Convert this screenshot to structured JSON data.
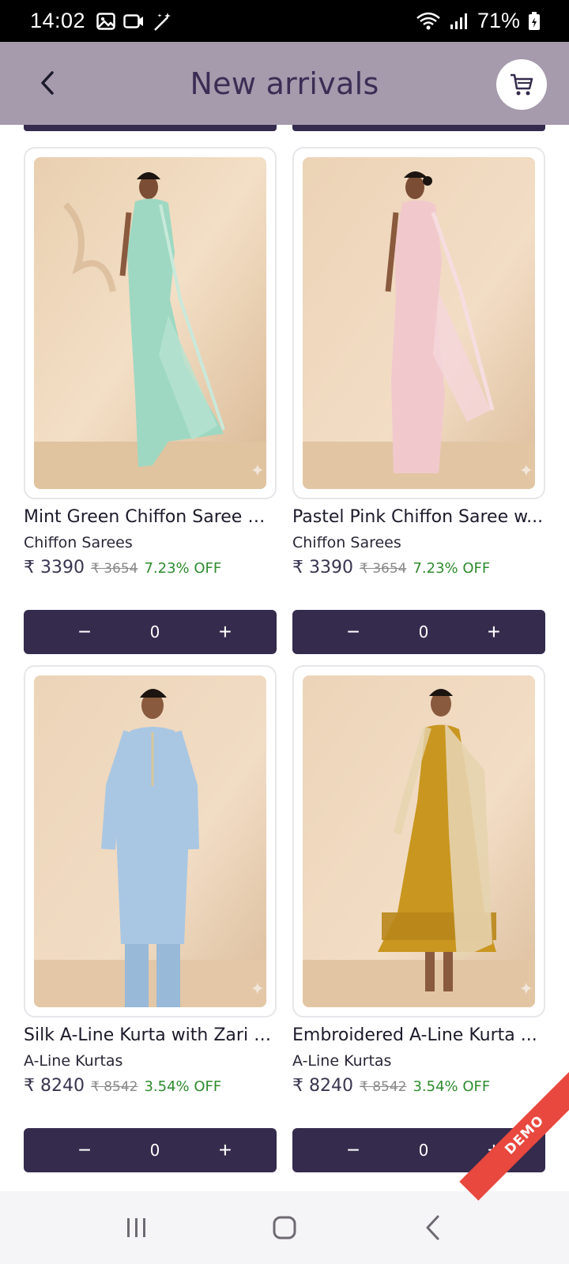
{
  "status_bar": {
    "time": "14:02",
    "battery": "71%"
  },
  "app_bar": {
    "title": "New arrivals"
  },
  "colors": {
    "app_bar_bg": "#a69aad",
    "title": "#3b2e55",
    "stepper_bg": "#352b4d",
    "discount_green": "#2e8b2e",
    "demo_ribbon": "#e8483e"
  },
  "products": [
    {
      "name": "Mint Green Chiffon Saree w...",
      "category": "Chiffon Sarees",
      "price": "₹ 3390",
      "mrp": "₹ 3654",
      "discount": "7.23% OFF",
      "quantity": "0",
      "image": "model-mint-green-saree"
    },
    {
      "name": "Pastel Pink Chiffon Saree w...",
      "category": "Chiffon Sarees",
      "price": "₹ 3390",
      "mrp": "₹ 3654",
      "discount": "7.23% OFF",
      "quantity": "0",
      "image": "model-pastel-pink-saree"
    },
    {
      "name": "Silk A-Line Kurta with Zari B...",
      "category": "A-Line Kurtas",
      "price": "₹ 8240",
      "mrp": "₹ 8542",
      "discount": "3.54% OFF",
      "quantity": "0",
      "image": "model-light-blue-kurta"
    },
    {
      "name": "Embroidered A-Line Kurta ...",
      "category": "A-Line Kurtas",
      "price": "₹ 8240",
      "mrp": "₹ 8542",
      "discount": "3.54% OFF",
      "quantity": "0",
      "image": "model-mustard-kurta-dupatta"
    }
  ],
  "stepper": {
    "minus": "−",
    "plus": "+"
  },
  "demo_badge": "DEMO",
  "nav_bar": {
    "icons": [
      "recent-apps-icon",
      "home-icon",
      "back-icon"
    ]
  }
}
